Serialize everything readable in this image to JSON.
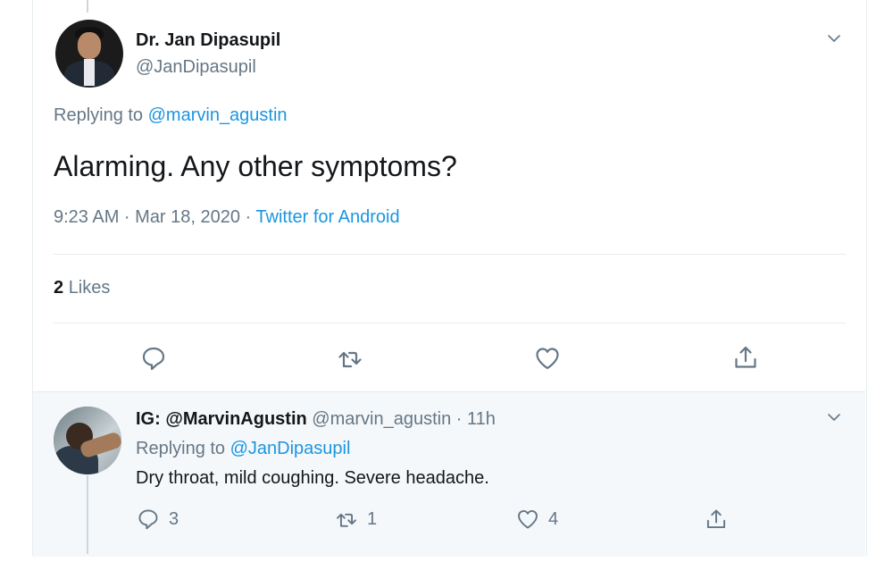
{
  "main_tweet": {
    "name": "Dr. Jan Dipasupil",
    "handle": "@JanDipasupil",
    "replying_prefix": "Replying to",
    "replying_to": "@marvin_agustin",
    "text": "Alarming. Any other symptoms?",
    "timestamp": "9:23 AM · Mar 18, 2020 · ",
    "source": "Twitter for Android",
    "likes_count": "2",
    "likes_label": "Likes"
  },
  "reply_tweet": {
    "name": "IG: @MarvinAgustin",
    "handle_time": "@marvin_agustin · 11h",
    "replying_prefix": "Replying to",
    "replying_to": "@JanDipasupil",
    "text": "Dry throat, mild coughing. Severe headache.",
    "reply_count": "3",
    "retweet_count": "1",
    "like_count": "4"
  },
  "icons": [
    "chevron-down-icon",
    "reply-icon",
    "retweet-icon",
    "heart-icon",
    "share-icon"
  ],
  "colors": {
    "link": "#1b95e0",
    "muted": "#657786",
    "text": "#14171a",
    "reply_bg": "#f5f8fa"
  }
}
